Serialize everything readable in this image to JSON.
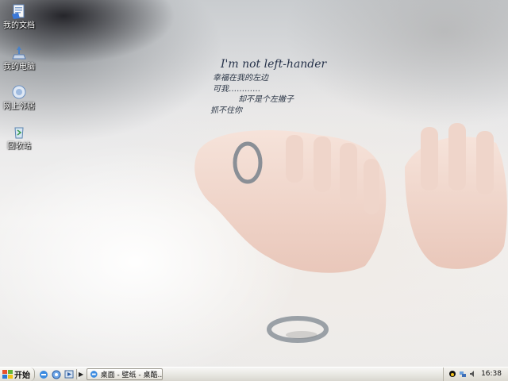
{
  "desktop": {
    "icons": [
      {
        "label": "我的文档",
        "icon": "my-documents-icon"
      },
      {
        "label": "我的电脑",
        "icon": "my-computer-icon"
      },
      {
        "label": "网上邻居",
        "icon": "network-places-icon"
      },
      {
        "label": "回收站",
        "icon": "recycle-bin-icon"
      }
    ]
  },
  "wallpaper": {
    "title": "I'm not left-hander",
    "lines": [
      "幸福在我的左边",
      "可我…………",
      "却不是个左撇子",
      "抓不住你"
    ]
  },
  "taskbar": {
    "start_label": "开始",
    "quick_launch": [
      "ie-icon",
      "show-desktop-icon",
      "media-player-icon"
    ],
    "task_label": "桌面 - 壁纸 - 桌酷...",
    "clock": "16:38",
    "tray_icons": [
      "qq-icon",
      "network-icon",
      "volume-icon"
    ]
  }
}
